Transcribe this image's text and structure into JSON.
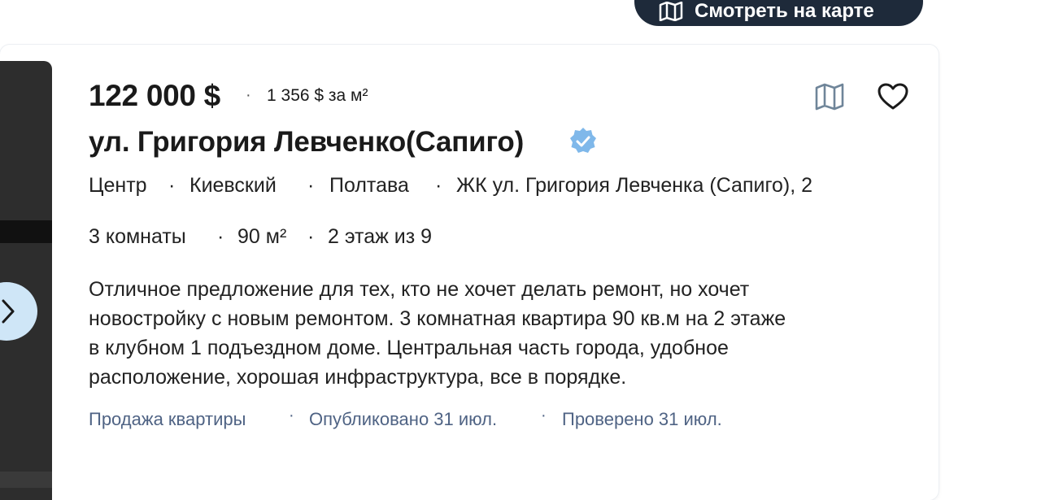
{
  "map_button": {
    "label": "Смотреть на карте",
    "icon": "map-icon"
  },
  "listing": {
    "price": "122 000 $",
    "price_per_m2": "1 356 $ за м²",
    "address": "ул. Григория Левченко(Сапиго)",
    "verified_icon": "verified-badge-icon",
    "location": [
      "Центр",
      "Киевский",
      "Полтава",
      "ЖК ул. Григория Левченка (Сапиго), 2"
    ],
    "params": [
      "3 комнаты",
      "90 м²",
      "2 этаж из 9"
    ],
    "description_lines": [
      "Отличное предложение для тех, кто не хочет делать ремонт, но хочет",
      "новостройку с новым ремонтом. 3 комнатная квартира 90 кв.м на 2 этаже",
      "в клубном 1 подъездном доме. Центральная часть города, удобное",
      "расположение, хорошая инфраструктура, все в порядке."
    ],
    "meta": [
      "Продажа квартиры",
      "Опубликовано 31 июл.",
      "Проверено 31 июл."
    ]
  },
  "separator": "·",
  "colors": {
    "verified": "#7fb8ea",
    "meta_text": "#4f6384",
    "map_button_bg": "#1e2a3a",
    "next_button_bg": "#cfe6f7"
  }
}
